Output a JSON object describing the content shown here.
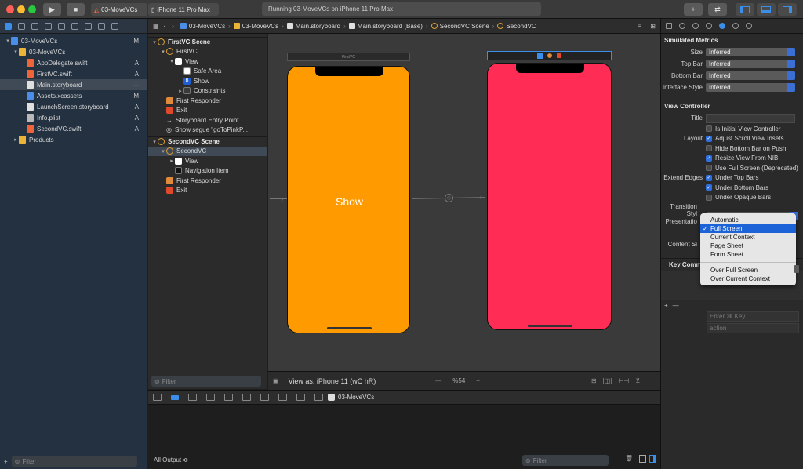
{
  "toolbar": {
    "scheme": "03-MoveVCs",
    "destination": "iPhone 11 Pro Max",
    "status": "Running 03-MoveVCs on iPhone 11 Pro Max",
    "add_label": "+",
    "swap_label": "⇄"
  },
  "navigator": {
    "items": [
      {
        "label": "03-MoveVCs",
        "status": "M",
        "type": "project",
        "indent": 0,
        "arrow": "▾"
      },
      {
        "label": "03-MoveVCs",
        "status": "",
        "type": "folder",
        "indent": 1,
        "arrow": "▾"
      },
      {
        "label": "AppDelegate.swift",
        "status": "A",
        "type": "swift",
        "indent": 2,
        "arrow": ""
      },
      {
        "label": "FirstVC.swift",
        "status": "A",
        "type": "swift",
        "indent": 2,
        "arrow": ""
      },
      {
        "label": "Main.storyboard",
        "status": "—",
        "type": "sb",
        "indent": 2,
        "arrow": "",
        "selected": true
      },
      {
        "label": "Assets.xcassets",
        "status": "M",
        "type": "asset",
        "indent": 2,
        "arrow": ""
      },
      {
        "label": "LaunchScreen.storyboard",
        "status": "A",
        "type": "sb",
        "indent": 2,
        "arrow": ""
      },
      {
        "label": "Info.plist",
        "status": "A",
        "type": "plist",
        "indent": 2,
        "arrow": ""
      },
      {
        "label": "SecondVC.swift",
        "status": "A",
        "type": "swift",
        "indent": 2,
        "arrow": ""
      },
      {
        "label": "Products",
        "status": "",
        "type": "folder",
        "indent": 1,
        "arrow": "▸"
      }
    ],
    "filter_placeholder": "Filter"
  },
  "jumpbar": {
    "crumbs": [
      "03-MoveVCs",
      "03-MoveVCs",
      "Main.storyboard",
      "Main.storyboard (Base)",
      "SecondVC Scene",
      "SecondVC"
    ]
  },
  "outline": {
    "items": [
      {
        "label": "FirstVC Scene",
        "indent": 0,
        "icon": "vc",
        "arrow": "▾",
        "head": true
      },
      {
        "label": "FirstVC",
        "indent": 1,
        "icon": "vc",
        "arrow": "▾"
      },
      {
        "label": "View",
        "indent": 2,
        "icon": "view",
        "arrow": "▾"
      },
      {
        "label": "Safe Area",
        "indent": 3,
        "icon": "safe",
        "arrow": ""
      },
      {
        "label": "Show",
        "indent": 3,
        "icon": "btnic",
        "arrow": ""
      },
      {
        "label": "Constraints",
        "indent": 3,
        "icon": "constr",
        "arrow": "▸"
      },
      {
        "label": "First Responder",
        "indent": 1,
        "icon": "fr",
        "arrow": ""
      },
      {
        "label": "Exit",
        "indent": 1,
        "icon": "ex",
        "arrow": ""
      },
      {
        "label": "Storyboard Entry Point",
        "indent": 1,
        "icon": "entry",
        "arrow": ""
      },
      {
        "label": "Show segue \"goToPinkP...",
        "indent": 1,
        "icon": "segue",
        "arrow": ""
      },
      {
        "label": "SecondVC Scene",
        "indent": 0,
        "icon": "vc",
        "arrow": "▾",
        "head": true
      },
      {
        "label": "SecondVC",
        "indent": 1,
        "icon": "vc",
        "arrow": "▾",
        "selected": true
      },
      {
        "label": "View",
        "indent": 2,
        "icon": "view",
        "arrow": "▸"
      },
      {
        "label": "Navigation Item",
        "indent": 2,
        "icon": "navitem",
        "arrow": ""
      },
      {
        "label": "First Responder",
        "indent": 1,
        "icon": "fr",
        "arrow": ""
      },
      {
        "label": "Exit",
        "indent": 1,
        "icon": "ex",
        "arrow": ""
      }
    ],
    "filter_placeholder": "Filter"
  },
  "canvas": {
    "first_vc_title": "FirstVC",
    "show_button": "Show",
    "first_color": "#ff9a00",
    "second_color": "#ff2d55",
    "view_as": "View as: iPhone 11 (wC hR)",
    "zoom": "%54"
  },
  "debug": {
    "target": "03-MoveVCs",
    "output_selector": "All Output ≎",
    "filter_placeholder": "Filter"
  },
  "inspector": {
    "simulated_metrics": "Simulated Metrics",
    "metrics": [
      {
        "label": "Size",
        "value": "Inferred"
      },
      {
        "label": "Top Bar",
        "value": "Inferred"
      },
      {
        "label": "Bottom Bar",
        "value": "Inferred"
      },
      {
        "label": "Interface Style",
        "value": "Inferred"
      }
    ],
    "view_controller": "View Controller",
    "title_label": "Title",
    "checks": [
      {
        "group": "",
        "label": "Is Initial View Controller",
        "on": false
      },
      {
        "group": "Layout",
        "label": "Adjust Scroll View Insets",
        "on": true
      },
      {
        "group": "",
        "label": "Hide Bottom Bar on Push",
        "on": false
      },
      {
        "group": "",
        "label": "Resize View From NIB",
        "on": true
      },
      {
        "group": "",
        "label": "Use Full Screen (Deprecated)",
        "on": false
      },
      {
        "group": "Extend Edges",
        "label": "Under Top Bars",
        "on": true
      },
      {
        "group": "",
        "label": "Under Bottom Bars",
        "on": true
      },
      {
        "group": "",
        "label": "Under Opaque Bars",
        "on": false
      }
    ],
    "transition_label": "Transition Styl",
    "presentation_label": "Presentatio",
    "content_size_label": "Content Si",
    "key_commands": "Key Commands",
    "key_placeholder": "Enter ⌘ Key",
    "action_placeholder": "action",
    "menu": [
      {
        "label": "Automatic",
        "checked": false,
        "hl": false
      },
      {
        "label": "Full Screen",
        "checked": true,
        "hl": true
      },
      {
        "label": "Current Context",
        "checked": false,
        "hl": false
      },
      {
        "label": "Page Sheet",
        "checked": false,
        "hl": false
      },
      {
        "label": "Form Sheet",
        "checked": false,
        "hl": false
      },
      {
        "sep": true
      },
      {
        "label": "Over Full Screen",
        "checked": false,
        "hl": false
      },
      {
        "label": "Over Current Context",
        "checked": false,
        "hl": false
      }
    ]
  }
}
